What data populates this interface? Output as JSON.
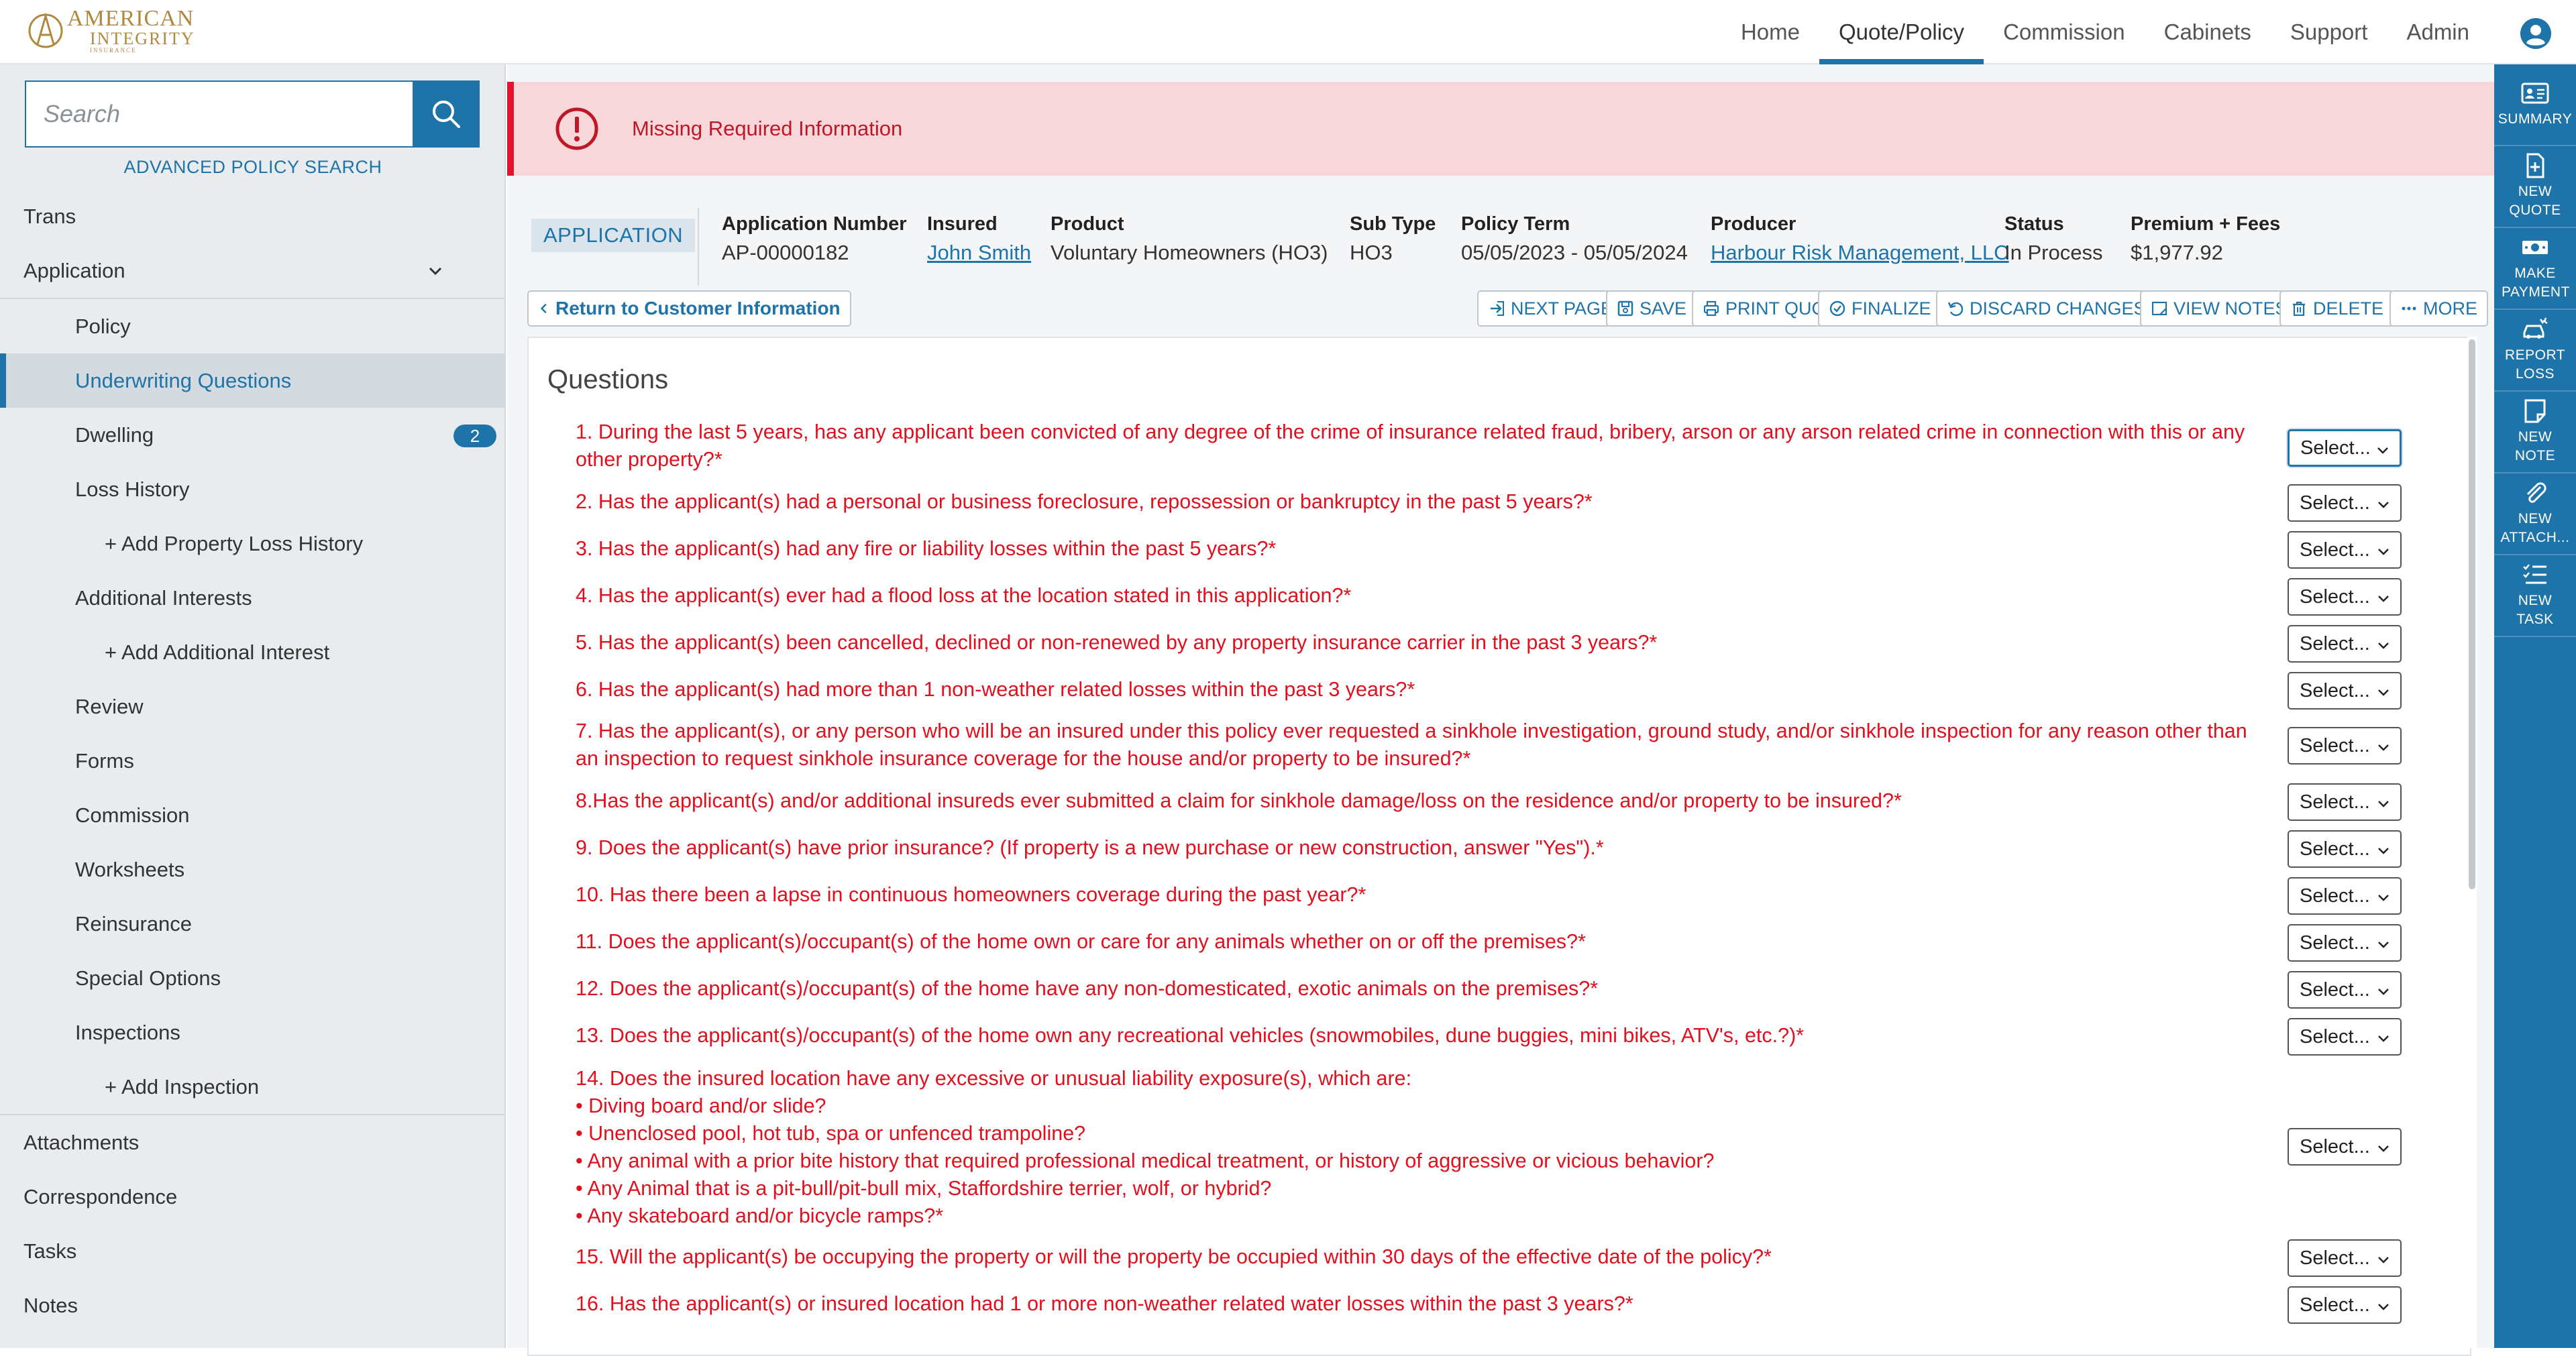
{
  "brand": {
    "line1": "AMERICAN",
    "line2": "INTEGRITY",
    "line3": "INSURANCE"
  },
  "nav": [
    {
      "label": "Home"
    },
    {
      "label": "Quote/Policy",
      "active": true
    },
    {
      "label": "Commission"
    },
    {
      "label": "Cabinets"
    },
    {
      "label": "Support"
    },
    {
      "label": "Admin"
    }
  ],
  "search": {
    "placeholder": "Search",
    "advanced_label": "ADVANCED POLICY SEARCH"
  },
  "sidebar": {
    "items": [
      {
        "label": "Trans",
        "level": 0
      },
      {
        "label": "Application",
        "level": 0,
        "expanded": true
      },
      {
        "label": "Policy",
        "level": 1
      },
      {
        "label": "Underwriting Questions",
        "level": 1,
        "active": true
      },
      {
        "label": "Dwelling",
        "level": 1,
        "badge": "2"
      },
      {
        "label": "Loss History",
        "level": 1
      },
      {
        "label": "+ Add Property Loss History",
        "level": 2
      },
      {
        "label": "Additional Interests",
        "level": 1
      },
      {
        "label": "+ Add Additional Interest",
        "level": 2
      },
      {
        "label": "Review",
        "level": 1
      },
      {
        "label": "Forms",
        "level": 1
      },
      {
        "label": "Commission",
        "level": 1
      },
      {
        "label": "Worksheets",
        "level": 1
      },
      {
        "label": "Reinsurance",
        "level": 1
      },
      {
        "label": "Special Options",
        "level": 1
      },
      {
        "label": "Inspections",
        "level": 1
      },
      {
        "label": "+ Add Inspection",
        "level": 2
      },
      {
        "label": "Attachments",
        "level": 0
      },
      {
        "label": "Correspondence",
        "level": 0
      },
      {
        "label": "Tasks",
        "level": 0
      },
      {
        "label": "Notes",
        "level": 0
      }
    ]
  },
  "rail": [
    {
      "label": "SUMMARY",
      "icon": "id-card-icon"
    },
    {
      "label": "NEW QUOTE",
      "icon": "new-document-icon"
    },
    {
      "label": "MAKE PAYMENT",
      "icon": "money-icon"
    },
    {
      "label": "REPORT LOSS",
      "icon": "car-crash-icon"
    },
    {
      "label": "NEW NOTE",
      "icon": "note-icon"
    },
    {
      "label": "NEW ATTACH...",
      "icon": "paperclip-icon"
    },
    {
      "label": "NEW TASK",
      "icon": "task-list-icon"
    }
  ],
  "alert": {
    "message": "Missing Required Information",
    "color": "#e0142c"
  },
  "application": {
    "tag": "APPLICATION",
    "fields": [
      {
        "label": "Application Number",
        "value": "AP-00000182"
      },
      {
        "label": "Insured",
        "value": "John Smith",
        "link": true
      },
      {
        "label": "Product",
        "value": "Voluntary Homeowners (HO3)"
      },
      {
        "label": "Sub Type",
        "value": "HO3"
      },
      {
        "label": "Policy Term",
        "value": "05/05/2023 - 05/05/2024"
      },
      {
        "label": "Producer",
        "value": "Harbour Risk Management, LLC",
        "link": true
      },
      {
        "label": "Status",
        "value": "In Process"
      },
      {
        "label": "Premium + Fees",
        "value": "$1,977.92"
      }
    ]
  },
  "toolbar": {
    "back_label": "Return to Customer Information",
    "buttons": [
      {
        "label": "NEXT PAGE",
        "icon": "next-page-icon"
      },
      {
        "label": "SAVE",
        "icon": "save-icon"
      },
      {
        "label": "PRINT QUOTE",
        "icon": "print-icon"
      },
      {
        "label": "FINALIZE",
        "icon": "check-circle-icon"
      },
      {
        "label": "DISCARD CHANGES",
        "icon": "undo-icon"
      },
      {
        "label": "VIEW NOTES",
        "icon": "view-notes-icon"
      },
      {
        "label": "DELETE",
        "icon": "trash-icon"
      },
      {
        "label": "MORE",
        "icon": "ellipsis-icon"
      }
    ]
  },
  "questions": {
    "title": "Questions",
    "select_placeholder": "Select...",
    "items": [
      {
        "text": "1. During the last 5 years, has any applicant been convicted of any degree of the crime of insurance related fraud, bribery, arson or any arson related crime in connection with this or any other property?*"
      },
      {
        "text": "2. Has the applicant(s) had a personal or business foreclosure, repossession or bankruptcy in the past 5 years?*"
      },
      {
        "text": "3. Has the applicant(s) had any fire or liability losses within the past 5 years?*"
      },
      {
        "text": "4. Has the applicant(s) ever had a flood loss at the location stated in this application?*"
      },
      {
        "text": "5. Has the applicant(s) been cancelled, declined or non-renewed by any property insurance carrier in the past 3 years?*"
      },
      {
        "text": "6. Has the applicant(s) had more than 1 non-weather related losses within the past 3 years?*"
      },
      {
        "text": "7. Has the applicant(s), or any person who will be an insured under this policy ever requested a sinkhole investigation, ground study, and/or sinkhole inspection for any reason other than an inspection to request sinkhole insurance coverage for the house and/or property to be insured?*"
      },
      {
        "text": "8.Has the applicant(s) and/or additional insureds ever submitted a claim for sinkhole damage/loss on the residence and/or property to be insured?*"
      },
      {
        "text": "9. Does the applicant(s) have prior insurance? (If property is a new purchase or new construction, answer \"Yes\").*"
      },
      {
        "text": "10. Has there been a lapse in continuous homeowners coverage during the past year?*"
      },
      {
        "text": "11. Does the applicant(s)/occupant(s) of the home own or care for any animals whether on or off the premises?*"
      },
      {
        "text": "12. Does the applicant(s)/occupant(s) of the home have any non-domesticated, exotic animals on the premises?*"
      },
      {
        "text": "13. Does the applicant(s)/occupant(s) of the home own any recreational vehicles (snowmobiles, dune buggies, mini bikes, ATV's, etc.?)*"
      },
      {
        "text": "14. Does the insured location have any excessive or unusual liability exposure(s), which are:",
        "bullets": [
          "• Diving board and/or slide?",
          "• Unenclosed pool, hot tub, spa or unfenced trampoline?",
          "• Any animal with a prior bite history that required professional medical treatment, or history of aggressive or vicious behavior?",
          "• Any Animal that is a pit-bull/pit-bull mix, Staffordshire terrier, wolf, or hybrid?",
          "• Any skateboard and/or bicycle ramps?*"
        ]
      },
      {
        "text": "15. Will the applicant(s) be occupying the property or will the property be occupied within 30 days of the effective date of the policy?*"
      },
      {
        "text": "16. Has the applicant(s) or insured location had 1 or more non-weather related water losses within the past 3 years?*"
      }
    ]
  }
}
